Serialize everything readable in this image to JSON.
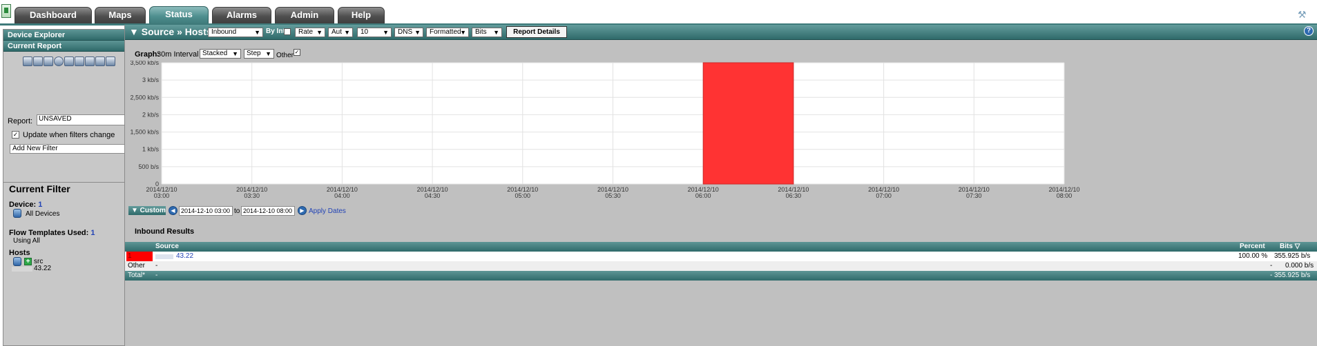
{
  "nav": {
    "tabs": [
      {
        "label": "Dashboard",
        "active": false
      },
      {
        "label": "Maps",
        "active": false
      },
      {
        "label": "Status",
        "active": true
      },
      {
        "label": "Alarms",
        "active": false
      },
      {
        "label": "Admin",
        "active": false
      },
      {
        "label": "Help",
        "active": false
      }
    ]
  },
  "sidebar": {
    "device_explorer": "Device Explorer",
    "current_report": "Current Report",
    "report_label": "Report:",
    "report_value": "UNSAVED",
    "update_label": "Update when filters change",
    "update_checked": true,
    "add_filter": "Add New Filter",
    "current_filter_title": "Current Filter",
    "device_label": "Device:",
    "device_count": "1",
    "device_value": "All Devices",
    "templates_label": "Flow Templates Used:",
    "templates_count": "1",
    "templates_value": "Using All",
    "hosts_label": "Hosts",
    "hosts_src": "src",
    "hosts_ip": "43.22"
  },
  "header": {
    "title": "▼ Source » Hosts",
    "direction": "Inbound",
    "by_int_label": "By Int",
    "rate": "Rate",
    "aut": "Aut",
    "count": "10",
    "dns": "DNS",
    "formatted": "Formatted",
    "bits": "Bits",
    "report_details": "Report Details",
    "help": "?"
  },
  "graph": {
    "label": "Graph:",
    "interval": "30m Interval",
    "mode": "Stacked",
    "style": "Step",
    "other_label": "Other",
    "other_checked": true
  },
  "chart_data": {
    "type": "area",
    "y_ticks": [
      "0",
      "500 b/s",
      "1 kb/s",
      "1,500 kb/s",
      "2 kb/s",
      "2,500 kb/s",
      "3 kb/s",
      "3,500 kb/s"
    ],
    "ylim": [
      0,
      3.5
    ],
    "x_ticks": [
      [
        "2014/12/10",
        "03:00"
      ],
      [
        "2014/12/10",
        "03:30"
      ],
      [
        "2014/12/10",
        "04:00"
      ],
      [
        "2014/12/10",
        "04:30"
      ],
      [
        "2014/12/10",
        "05:00"
      ],
      [
        "2014/12/10",
        "05:30"
      ],
      [
        "2014/12/10",
        "06:00"
      ],
      [
        "2014/12/10",
        "06:30"
      ],
      [
        "2014/12/10",
        "07:00"
      ],
      [
        "2014/12/10",
        "07:30"
      ],
      [
        "2014/12/10",
        "08:00"
      ]
    ],
    "series": [
      {
        "color": "#ff3333",
        "x_start": "06:00",
        "x_end": "06:30",
        "value_kbps": 3.5
      }
    ],
    "grid": true
  },
  "daterange": {
    "custom_label": "▼ Custom",
    "start": "2014-12-10 03:00",
    "to_label": "to",
    "end": "2014-12-10 08:00",
    "apply": "Apply Dates"
  },
  "results": {
    "title": "Inbound Results",
    "columns": {
      "source": "Source",
      "percent": "Percent",
      "bits": "Bits"
    },
    "rows": [
      {
        "rank": "1",
        "source": "43.22",
        "percent": "100.00 %",
        "bits": "355.925 b/s",
        "color": "#ff0000"
      },
      {
        "rank": "Other",
        "source": "-",
        "percent": "-",
        "bits": "0.000 b/s"
      },
      {
        "rank": "Total*",
        "source": "-",
        "percent": "-",
        "bits": "355.925 b/s"
      }
    ]
  }
}
